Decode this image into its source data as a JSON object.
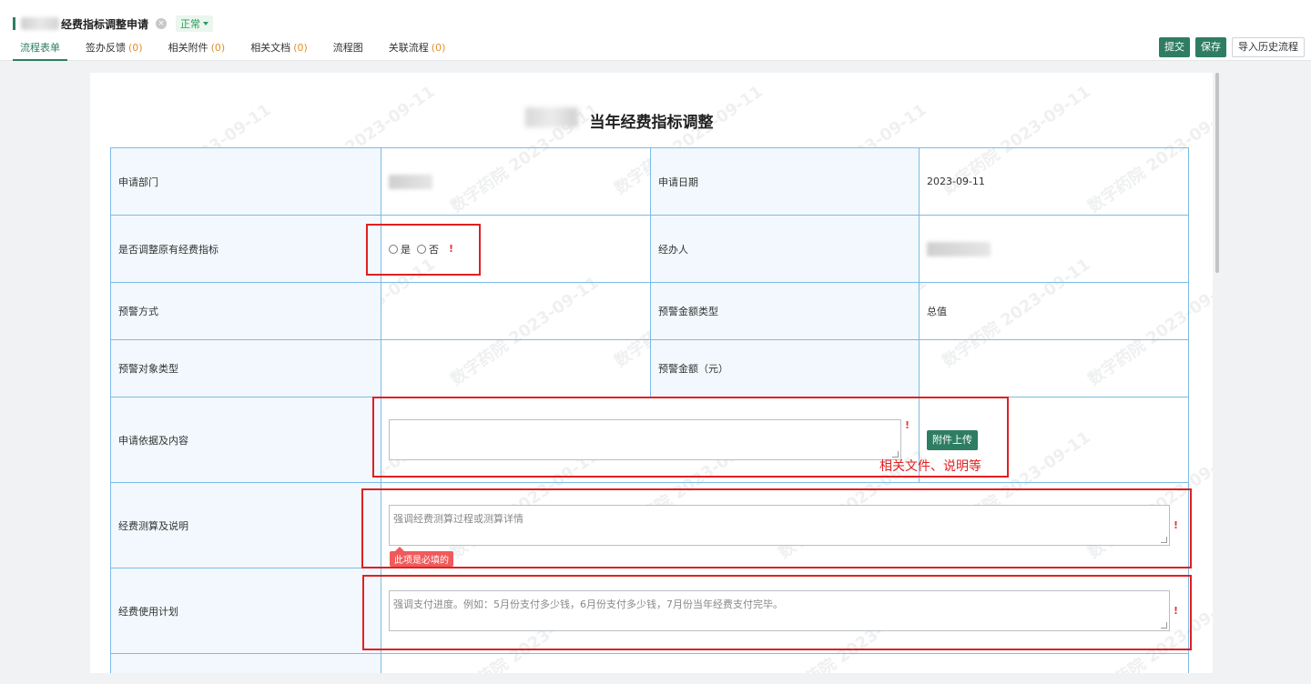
{
  "header": {
    "title": "经费指标调整申请",
    "status": "正常"
  },
  "tabs": [
    {
      "label": "流程表单",
      "count": ""
    },
    {
      "label": "签办反馈",
      "count": "(0)"
    },
    {
      "label": "相关附件",
      "count": "(0)"
    },
    {
      "label": "相关文档",
      "count": "(0)"
    },
    {
      "label": "流程图",
      "count": ""
    },
    {
      "label": "关联流程",
      "count": "(0)"
    }
  ],
  "actions": {
    "submit": "提交",
    "save": "保存",
    "import_history": "导入历史流程"
  },
  "form": {
    "title": "当年经费指标调整",
    "watermark": "数字药院 2023-09-11",
    "rows": {
      "dept_label": "申请部门",
      "date_label": "申请日期",
      "date_value": "2023-09-11",
      "adjust_label": "是否调整原有经费指标",
      "yes": "是",
      "no": "否",
      "handler_label": "经办人",
      "warn_method_label": "预警方式",
      "warn_amount_type_label": "预警金额类型",
      "warn_amount_type_value": "总值",
      "warn_target_label": "预警对象类型",
      "warn_amount_label": "预警金额（元）",
      "basis_label": "申请依据及内容",
      "upload_button": "附件上传",
      "calc_label": "经费测算及说明",
      "calc_placeholder": "强调经费测算过程或测算详情",
      "required_tip": "此项是必填的",
      "plan_label": "经费使用计划",
      "plan_placeholder": "强调支付进度。例如：5月份支付多少钱，6月份支付多少钱，7月份当年经费支付完毕。"
    },
    "required_mark": "!"
  },
  "annotation": {
    "note": "相关文件、说明等"
  }
}
